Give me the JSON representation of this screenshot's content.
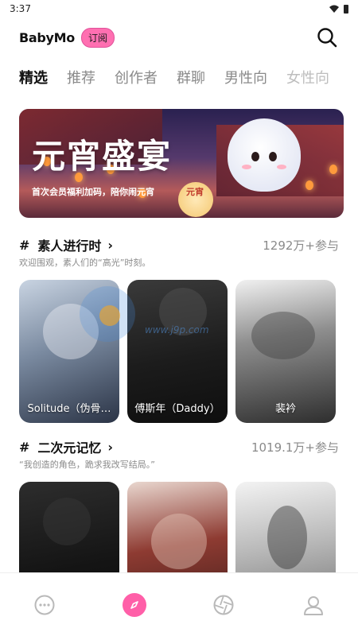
{
  "status_bar": {
    "time": "3:37"
  },
  "header": {
    "logo": "BabyMo",
    "subscribe_label": "订阅"
  },
  "tabs": [
    {
      "label": "精选",
      "active": true
    },
    {
      "label": "推荐",
      "active": false
    },
    {
      "label": "创作者",
      "active": false
    },
    {
      "label": "群聊",
      "active": false
    },
    {
      "label": "男性向",
      "active": false
    },
    {
      "label": "女性向",
      "active": false
    }
  ],
  "banner": {
    "title": "元宵盛宴",
    "subtitle": "首次会员福利加码，陪你闹元宵",
    "lantern_text": "元宵"
  },
  "sections": [
    {
      "hash": "#",
      "title": "素人进行时",
      "chevron": "›",
      "count": "1292万+参与",
      "desc": "欢迎围观，素人们的“高光”时刻。",
      "cards": [
        {
          "label": "Solitude（伪骨…"
        },
        {
          "label": "傅斯年（Daddy）"
        },
        {
          "label": "裴衿"
        }
      ]
    },
    {
      "hash": "#",
      "title": "二次元记忆",
      "chevron": "›",
      "count": "1019.1万+参与",
      "desc": "“我创造的角色，跪求我改写结局。”",
      "cards": [
        {
          "label": ""
        },
        {
          "label": ""
        },
        {
          "label": ""
        }
      ]
    }
  ],
  "watermark": {
    "text": "www.j9p.com"
  },
  "bottom_nav": [
    {
      "icon": "chat-bubble-icon",
      "active": false
    },
    {
      "icon": "compass-icon",
      "active": true
    },
    {
      "icon": "aperture-icon",
      "active": false
    },
    {
      "icon": "profile-icon",
      "active": false
    }
  ],
  "colors": {
    "accent": "#ff5fa8",
    "badge": "#ff6fb1",
    "muted": "#8a8a8a"
  }
}
